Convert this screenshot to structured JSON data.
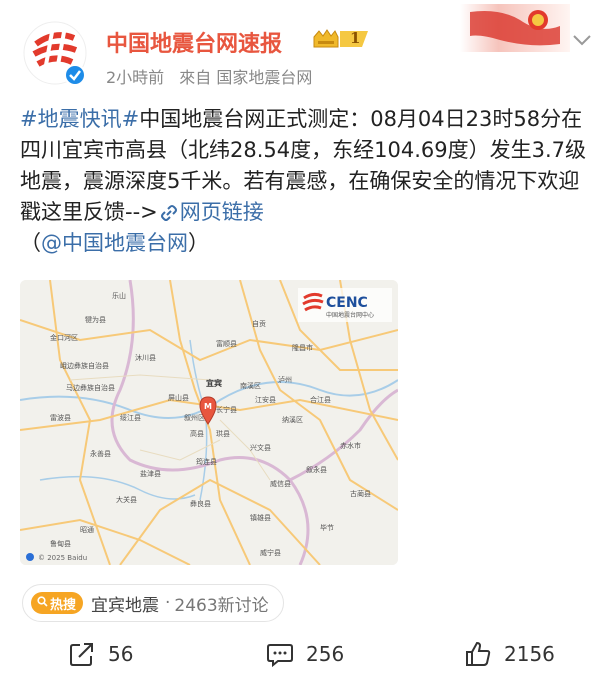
{
  "account": {
    "name": "中国地震台网速报",
    "level": "1",
    "time": "2小時前",
    "source": "來自 国家地震台网",
    "avatar_icon": "cenc-logo-icon",
    "verified_icon": "verified-check-icon"
  },
  "post": {
    "hashtag": "#地震快讯#",
    "text": "中国地震台网正式测定：08月04日23时58分在四川宜宾市高县（北纬28.54度，东经104.69度）发生3.7级地震，震源深度5千米。若有震感，在确保安全的情况下欢迎戳这里反馈-->",
    "link_label": "网页链接",
    "mention_open": "（",
    "mention": "@中国地震台网",
    "mention_close": "）"
  },
  "map": {
    "logo_text": "CENC",
    "logo_subtitle": "中国地震台网中心",
    "epicenter_marker": "M",
    "labels": {
      "yibin": "宜宾",
      "gaoxian": "高县",
      "luzhou": "泸州",
      "changning": "长宁县",
      "gongxian": "珙县",
      "junlian": "筠连县",
      "leshan": "乐山",
      "zigong": "自贡",
      "yanjin": "盐津县",
      "pingshan": "屏山县",
      "xingwen": "兴文县",
      "jiangan": "江安县",
      "nanxi": "南溪区",
      "weixin": "威信县",
      "daguan": "大关县",
      "suijiang": "绥江县",
      "mabian": "马边彝族自治县",
      "leibo": "雷波县",
      "yongshan": "永善县",
      "naxi": "纳溪区",
      "gulin": "古蔺县",
      "xuyong": "叙永县",
      "yiliang": "彝良县",
      "zhenxiong": "镇雄县",
      "muchuan": "沐川县",
      "qianwei": "犍为县",
      "xuzhou": "叙州区",
      "fushun": "富顺县",
      "longchang": "隆昌市",
      "jinkouhe": "金口河区",
      "ebian": "峨边彝族自治县",
      "zhaotong": "昭通",
      "ludian": "鲁甸县",
      "yiliang2": "威宁县",
      "hejiang": "合江县",
      "chishui": "赤水市",
      "bijie": "毕节"
    },
    "copyright": "© 2025 Baidu"
  },
  "topic": {
    "badge_label": "热搜",
    "badge_icon": "search-icon",
    "name": "宜宾地震",
    "separator": "·",
    "count": "2463新讨论"
  },
  "actions": {
    "share_count": "56",
    "comment_count": "256",
    "like_count": "2156"
  },
  "colors": {
    "accent_red": "#e8563f",
    "link_blue": "#3b6ea8",
    "hot_orange": "#f6a523"
  }
}
